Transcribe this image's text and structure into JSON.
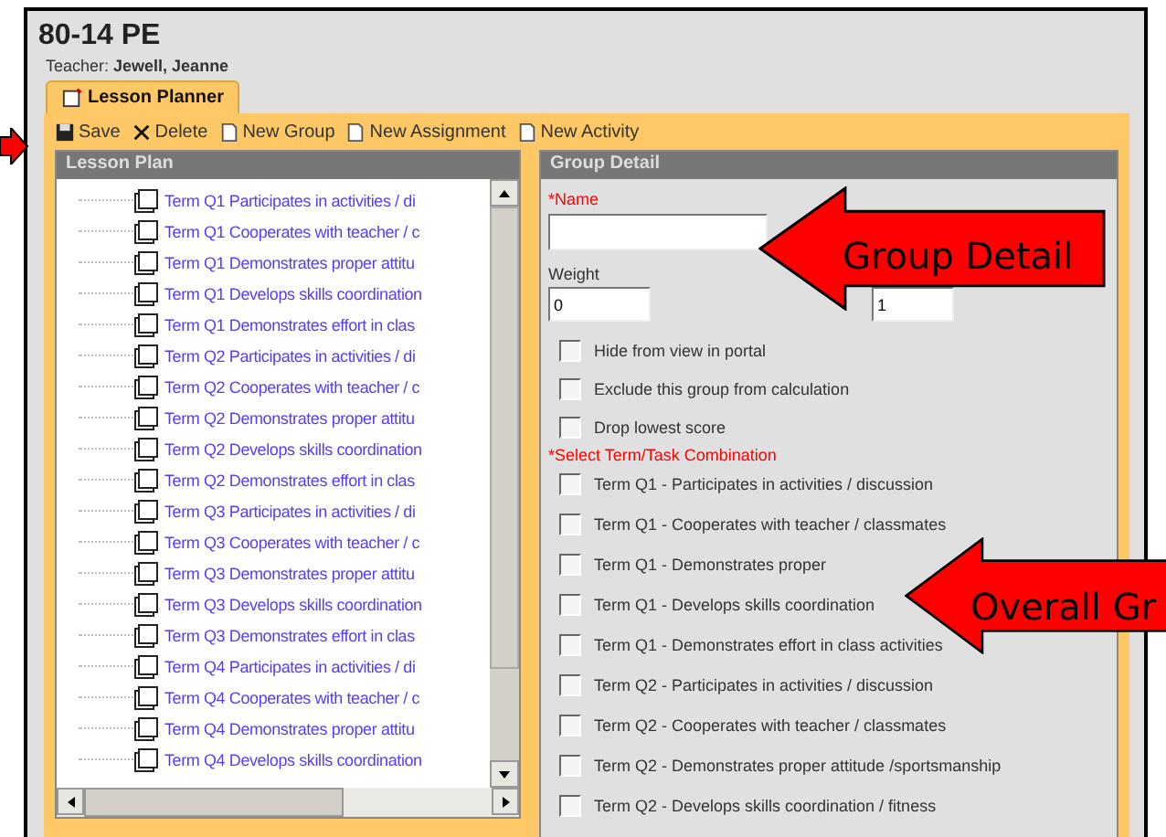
{
  "header": {
    "title": "80-14 PE",
    "teacher_label": "Teacher:",
    "teacher": "Jewell, Jeanne"
  },
  "tabs": [
    {
      "label": "Lesson Planner",
      "selected": true
    }
  ],
  "toolbar": [
    {
      "label": "Save",
      "kind": "save"
    },
    {
      "label": "Delete",
      "kind": "delete"
    },
    {
      "label": "New Group",
      "kind": "new"
    },
    {
      "label": "New Assignment",
      "kind": "new"
    },
    {
      "label": "New Activity",
      "kind": "new"
    }
  ],
  "lesson_plan": {
    "title": "Lesson Plan",
    "items": [
      "Term Q1 Participates in activities / di",
      "Term Q1 Cooperates with teacher / c",
      "Term Q1 Demonstrates proper attitu",
      "Term Q1 Develops skills coordination",
      "Term Q1 Demonstrates effort in clas",
      "Term Q2 Participates in activities / di",
      "Term Q2 Cooperates with teacher / c",
      "Term Q2 Demonstrates proper attitu",
      "Term Q2 Develops skills coordination",
      "Term Q2 Demonstrates effort in clas",
      "Term Q3 Participates in activities / di",
      "Term Q3 Cooperates with teacher / c",
      "Term Q3 Demonstrates proper attitu",
      "Term Q3 Develops skills coordination",
      "Term Q3 Demonstrates effort in clas",
      "Term Q4 Participates in activities / di",
      "Term Q4 Cooperates with teacher / c",
      "Term Q4 Demonstrates proper attitu",
      "Term Q4 Develops skills coordination"
    ]
  },
  "group_detail": {
    "title": "Group Detail",
    "name_label": "*Name",
    "weight_label": "Weight",
    "weight_value": "0",
    "sequence_value": "1",
    "options": [
      {
        "label": "Hide from view in portal",
        "checked": false
      },
      {
        "label": "Exclude this group from calculation",
        "checked": false
      },
      {
        "label": "Drop lowest score",
        "checked": false
      }
    ],
    "combination_label": "*Select Term/Task Combination",
    "combinations": [
      {
        "label": "Term Q1 - Participates in activities / discussion",
        "checked": false
      },
      {
        "label": "Term Q1 - Cooperates with teacher / classmates",
        "checked": false
      },
      {
        "label": "Term Q1 - Demonstrates proper",
        "checked": false
      },
      {
        "label": "Term Q1 - Develops skills coordination",
        "checked": false
      },
      {
        "label": "Term Q1 - Demonstrates effort in class activities",
        "checked": false
      },
      {
        "label": "Term Q2 - Participates in activities / discussion",
        "checked": false
      },
      {
        "label": "Term Q2 - Cooperates with teacher / classmates",
        "checked": false
      },
      {
        "label": "Term Q2 - Demonstrates proper attitude /sportsmanship",
        "checked": false
      },
      {
        "label": "Term Q2 - Develops skills coordination / fitness",
        "checked": false
      }
    ]
  },
  "annotations": [
    {
      "label": "Group Detail"
    },
    {
      "label": "Overall Gr"
    }
  ]
}
